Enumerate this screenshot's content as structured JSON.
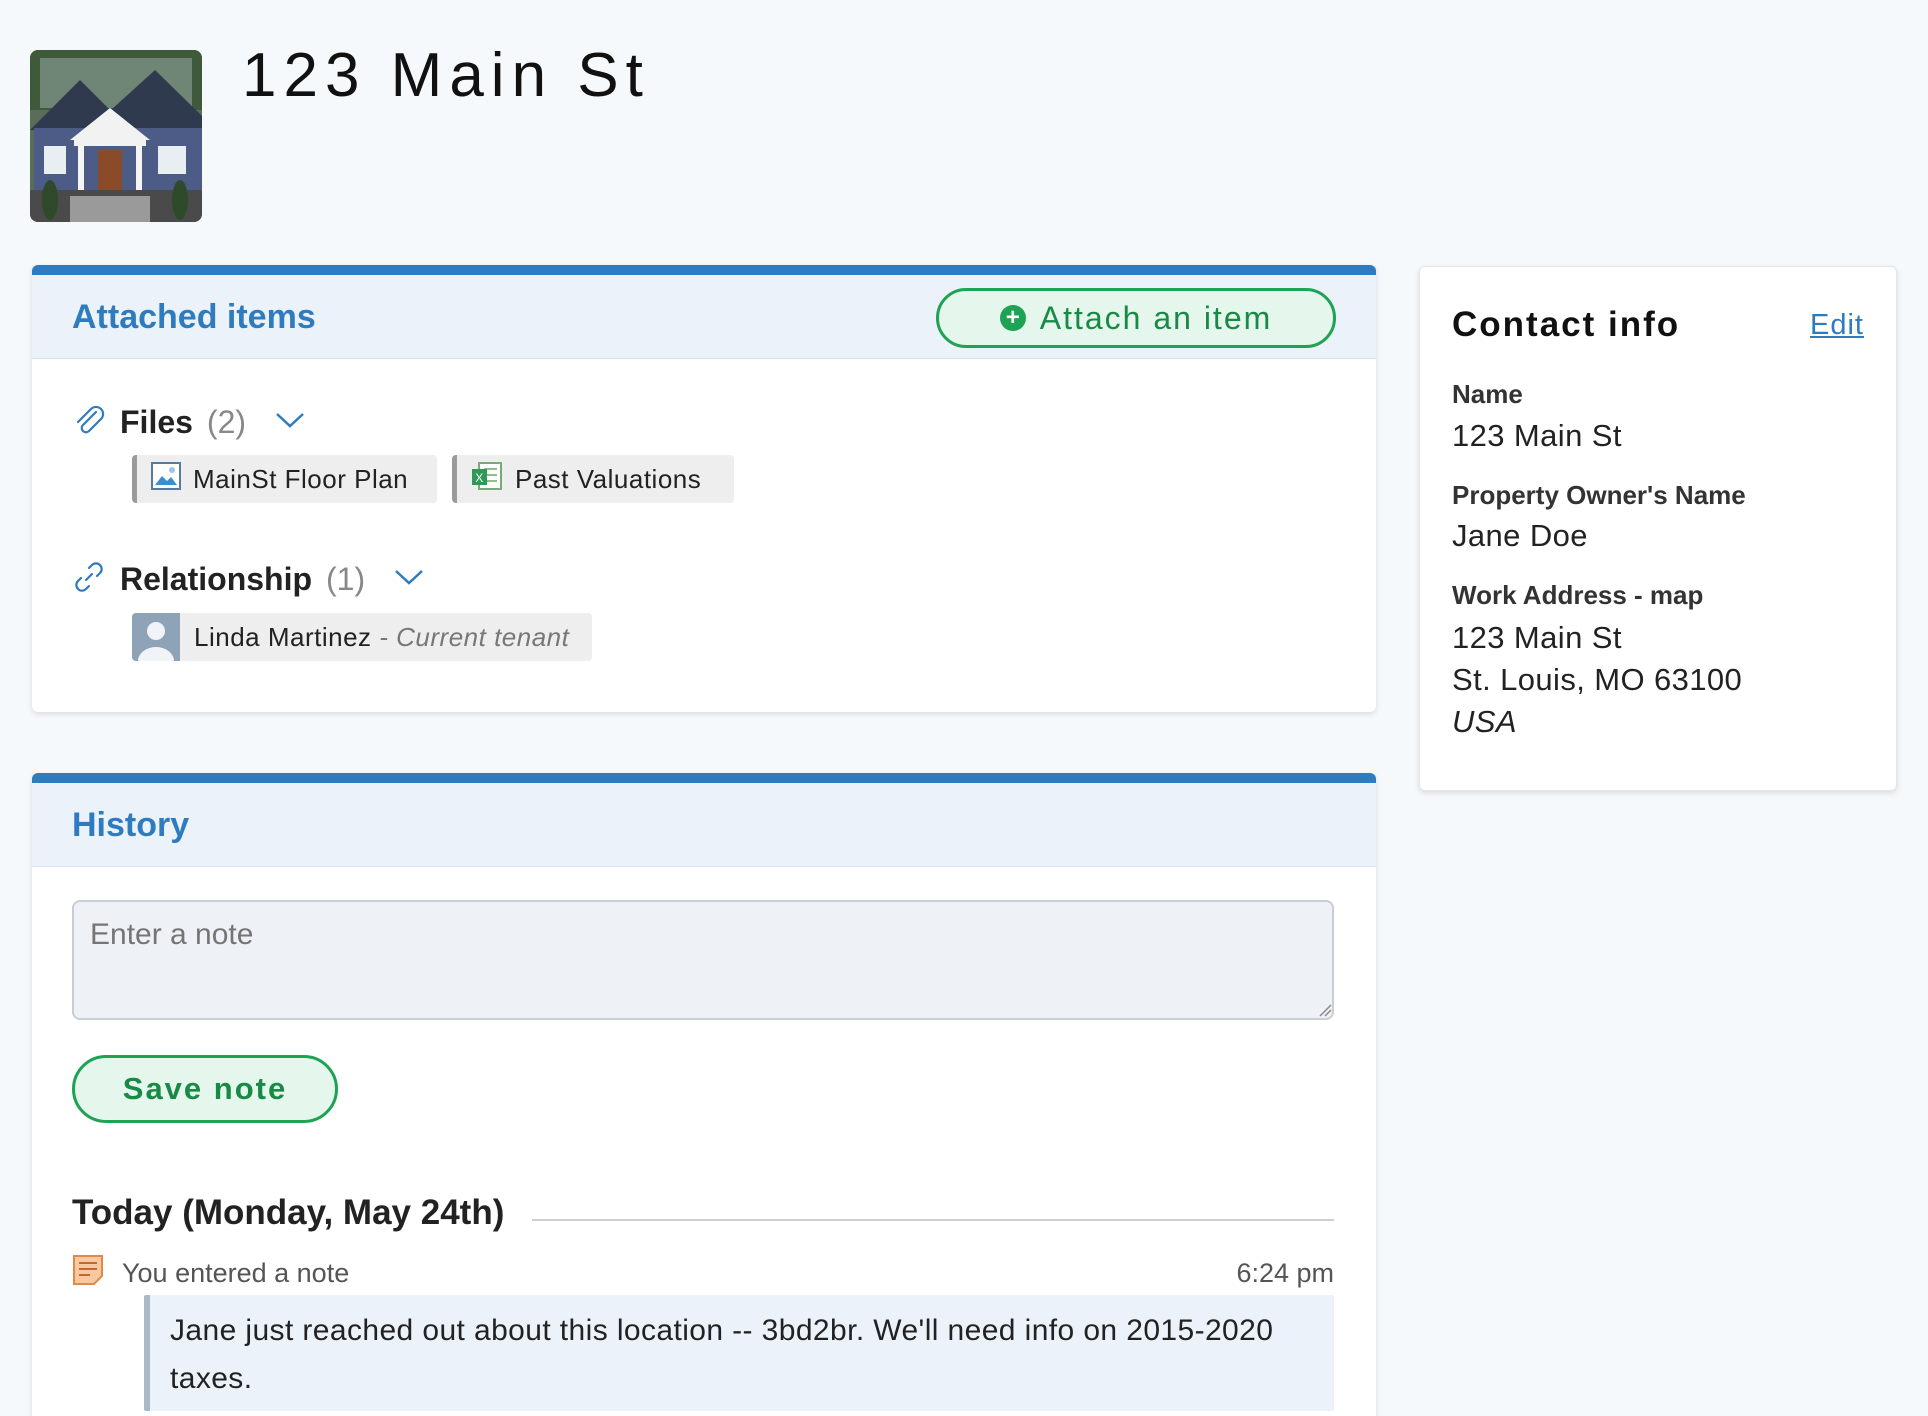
{
  "page": {
    "title": "123 Main St"
  },
  "attached": {
    "title": "Attached items",
    "attach_label": "Attach an item",
    "files": {
      "label": "Files",
      "count": "(2)",
      "items": [
        {
          "name": "MainSt Floor Plan",
          "icon": "image-file-icon"
        },
        {
          "name": "Past Valuations",
          "icon": "excel-file-icon"
        }
      ]
    },
    "relationship": {
      "label": "Relationship",
      "count": "(1)",
      "items": [
        {
          "name": "Linda Martinez",
          "role": " - Current tenant"
        }
      ]
    }
  },
  "history": {
    "title": "History",
    "note_placeholder": "Enter a note",
    "save_label": "Save note",
    "day": "Today (Monday, May 24th)",
    "entries": [
      {
        "action": "You entered a note",
        "time": "6:24 pm",
        "body": "Jane just reached out about this location -- 3bd2br. We'll need info on 2015-2020 taxes."
      }
    ]
  },
  "contact": {
    "title": "Contact info",
    "edit_label": "Edit",
    "name_label": "Name",
    "name_value": "123 Main St",
    "owner_label": "Property Owner's Name",
    "owner_value": "Jane Doe",
    "address_label": "Work Address - map",
    "address_line1": "123 Main St",
    "address_line2": "St. Louis, MO 63100",
    "address_country": "USA"
  },
  "colors": {
    "accent_blue": "#2e7cbf",
    "accent_green": "#1ea254"
  }
}
